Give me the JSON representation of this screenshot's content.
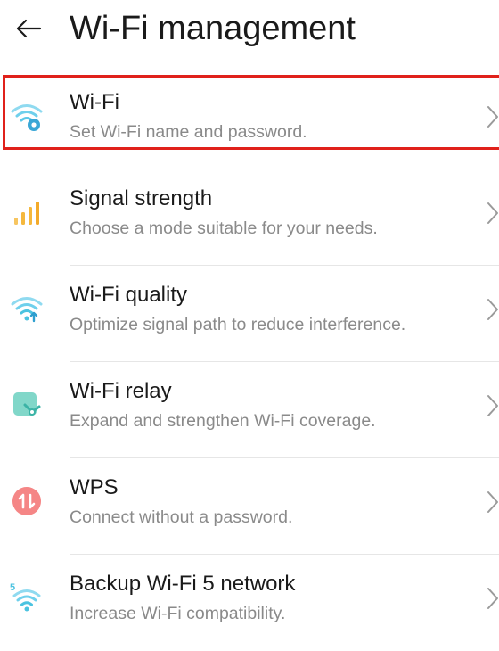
{
  "header": {
    "title": "Wi-Fi management",
    "back_icon": "arrow-left-icon"
  },
  "items": [
    {
      "label": "Wi-Fi",
      "description": "Set Wi-Fi name and password.",
      "icon": "wifi-settings-icon",
      "icon_color": "#5cc8e8"
    },
    {
      "label": "Signal strength",
      "description": "Choose a mode suitable for your needs.",
      "icon": "signal-bars-icon",
      "icon_color": "#f5b83d"
    },
    {
      "label": "Wi-Fi quality",
      "description": "Optimize signal path to reduce interference.",
      "icon": "wifi-quality-icon",
      "icon_color": "#4bc3e0"
    },
    {
      "label": "Wi-Fi relay",
      "description": "Expand and strengthen Wi-Fi coverage.",
      "icon": "wifi-relay-icon",
      "icon_color": "#6ccfc0"
    },
    {
      "label": "WPS",
      "description": "Connect without a password.",
      "icon": "wps-icon",
      "icon_color": "#f26a6a"
    },
    {
      "label": "Backup Wi-Fi 5 network",
      "description": "Increase Wi-Fi compatibility.",
      "icon": "wifi-5-icon",
      "icon_color": "#4bc3e0"
    }
  ],
  "highlight_color": "#e0211b"
}
